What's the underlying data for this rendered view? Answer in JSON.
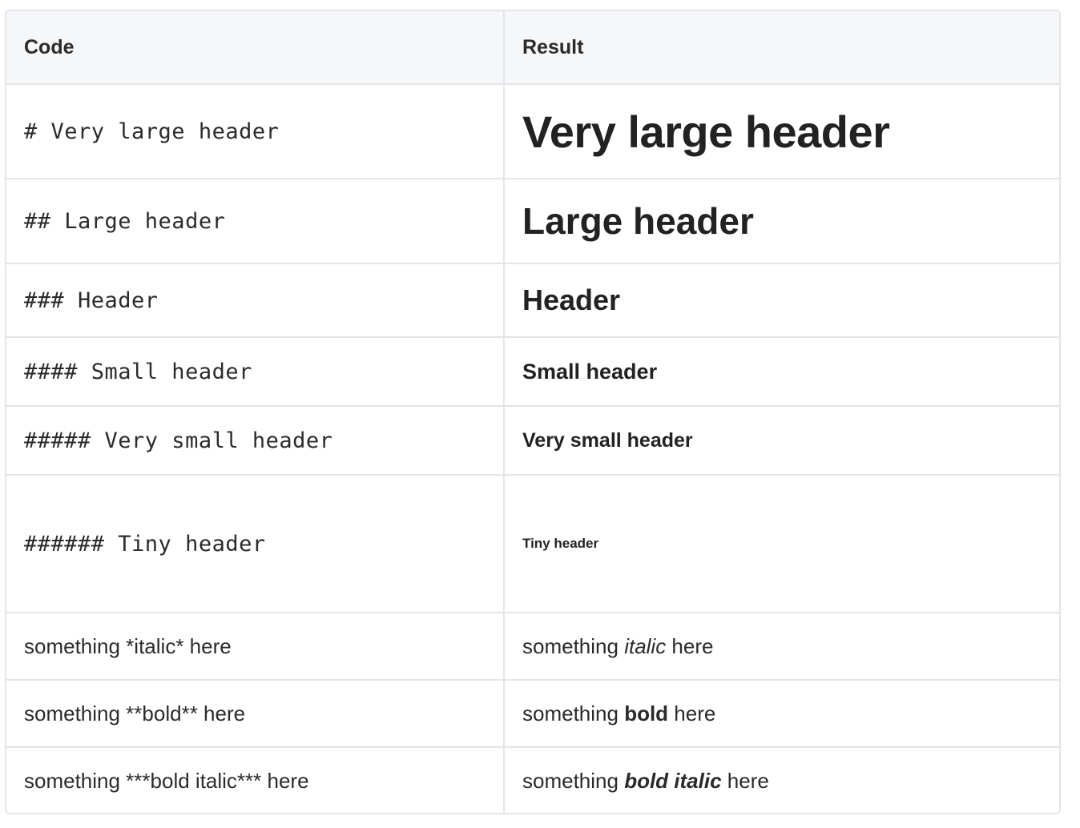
{
  "table": {
    "headers": {
      "code": "Code",
      "result": "Result"
    },
    "rows": [
      {
        "code": "# Very large header",
        "result": "Very large header"
      },
      {
        "code": "## Large header",
        "result": "Large header"
      },
      {
        "code": "### Header",
        "result": "Header"
      },
      {
        "code": "#### Small header",
        "result": "Small header"
      },
      {
        "code": "##### Very small header",
        "result": "Very small header"
      },
      {
        "code": "###### Tiny header",
        "result": "Tiny header"
      },
      {
        "code": "something *italic* here",
        "result_pre": "something ",
        "result_em": "italic",
        "result_post": " here"
      },
      {
        "code": "something **bold** here",
        "result_pre": "something ",
        "result_strong": "bold",
        "result_post": " here"
      },
      {
        "code": "something ***bold italic*** here",
        "result_pre": "something ",
        "result_strong_em": "bold italic",
        "result_post": " here"
      }
    ]
  }
}
